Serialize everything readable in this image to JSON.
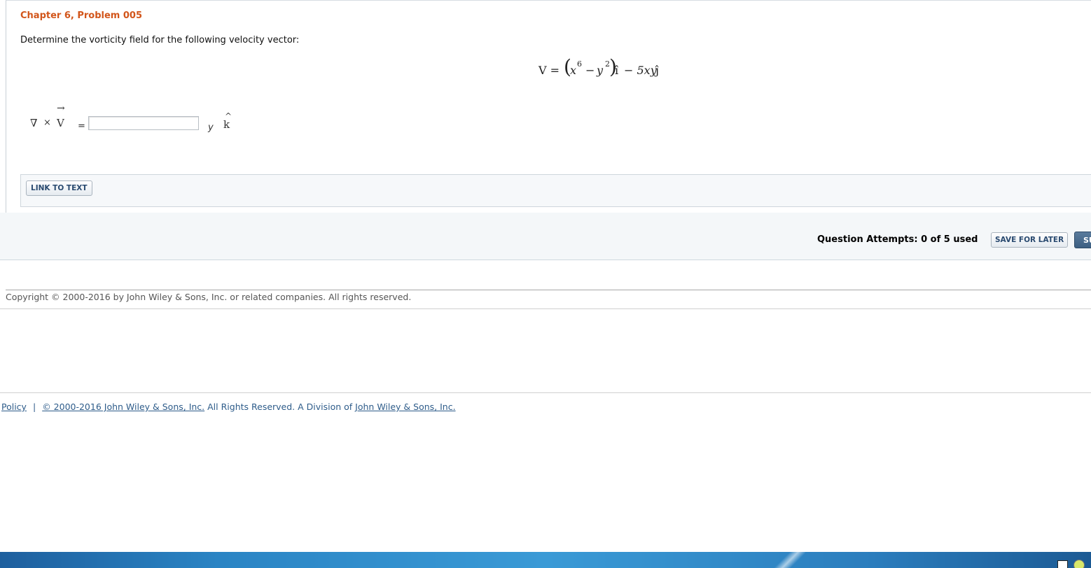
{
  "problem": {
    "title": "Chapter 6, Problem 005",
    "prompt": "Determine the vorticity field for the following velocity vector:",
    "equation": {
      "lhs": "V =",
      "open_paren": "(",
      "x": "x",
      "x_exp": "6",
      "minus": "−",
      "y": "y",
      "y_exp": "2",
      "close_paren": ")",
      "i_hat": "î",
      "term2": "− 5xy",
      "j_hat": "ĵ"
    },
    "answer": {
      "nabla": "∇",
      "cross": "×",
      "arrow": "→",
      "v": "V",
      "equals": "=",
      "input_value": "",
      "unit": "y",
      "k_hat_mark": "^",
      "k": "k"
    },
    "link_to_text": "LINK TO TEXT"
  },
  "attempts": {
    "label": "Question Attempts: 0 of 5 used",
    "save_label": "SAVE FOR LATER",
    "submit_label": "SU"
  },
  "copyright": "Copyright © 2000-2016 by John Wiley & Sons, Inc. or related companies. All rights reserved.",
  "footer": {
    "policy": "Policy",
    "separator": "|",
    "link1": "© 2000-2016 John Wiley & Sons, Inc.",
    "middle": " All Rights Reserved. A Division of ",
    "link2": "John Wiley & Sons, Inc."
  },
  "taskbar": {
    "icons": [
      "tray-flag-icon",
      "tray-smiley-icon"
    ]
  }
}
